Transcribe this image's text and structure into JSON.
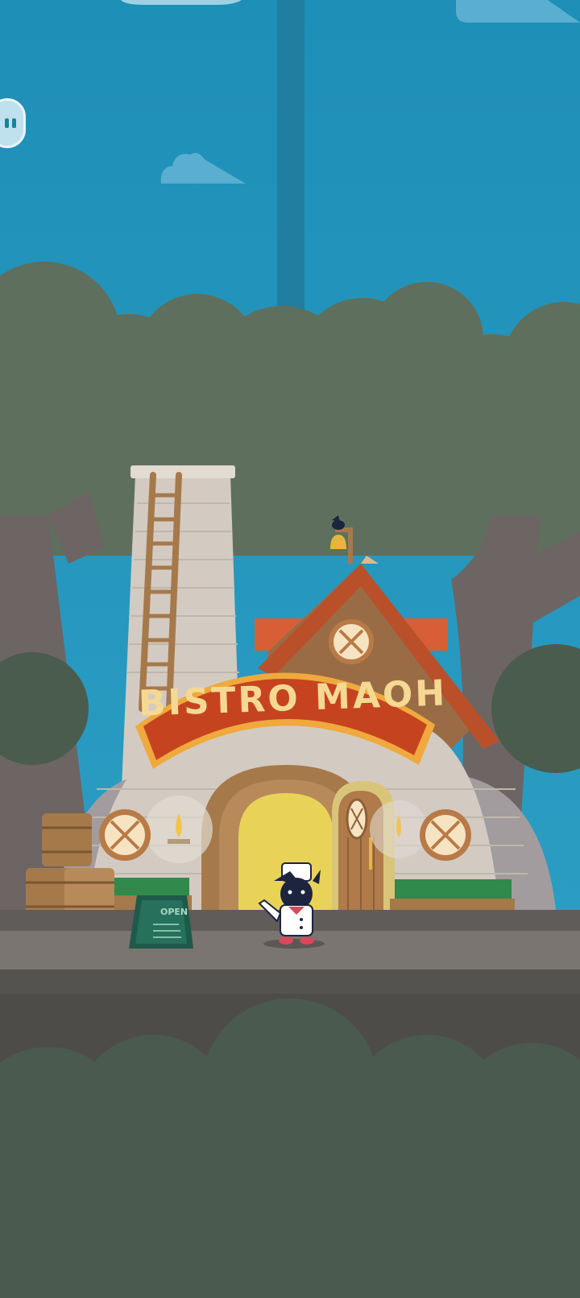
{
  "scene": {
    "name": "Bistro Maoh storefront",
    "sign_text": "BISTRO MAOH",
    "board_text": "OPEN"
  },
  "controls": {
    "pause_icon": "pause-icon"
  },
  "palette": {
    "sky": "#2493b9",
    "trees": "#5f6f5d",
    "ground": "#6b6661",
    "roof": "#b9502a",
    "sign_red": "#c5441f",
    "sign_text": "#f5d992",
    "door_light": "#e8d358"
  }
}
